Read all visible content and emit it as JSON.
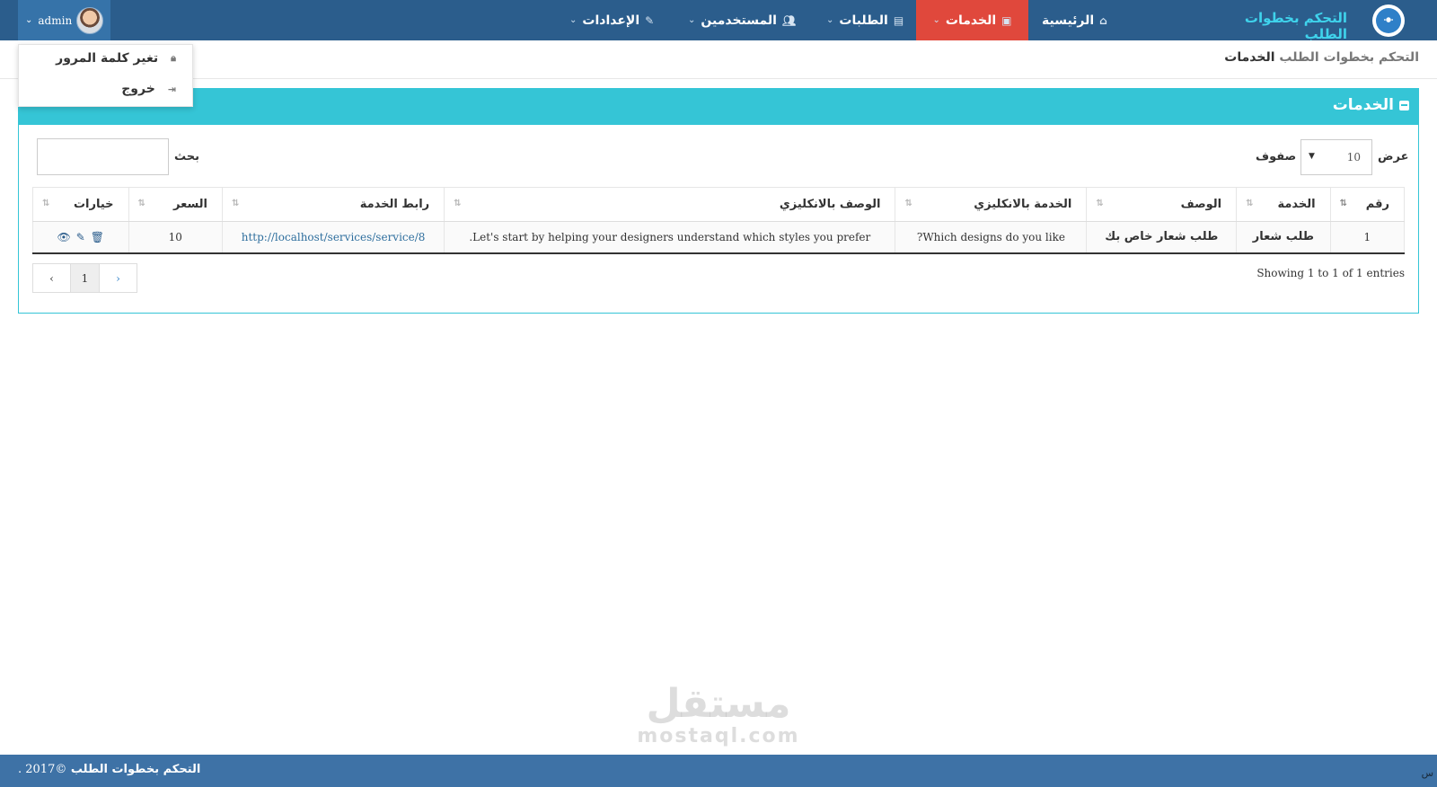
{
  "brand": {
    "name": "التحكم بخطوات الطلب",
    "logo_icon": "people-logo-icon"
  },
  "nav": {
    "items": [
      {
        "label": "الرئيسية",
        "icon": "home-icon"
      },
      {
        "label": "الخدمات",
        "icon": "box-icon",
        "active": true
      },
      {
        "label": "الطلبات",
        "icon": "file-icon"
      },
      {
        "label": "المستخدمين",
        "icon": "users-icon"
      },
      {
        "label": "الإعدادات",
        "icon": "wrench-icon"
      }
    ]
  },
  "user": {
    "name": "admin"
  },
  "dropdown": {
    "change_password": "تغير كلمة المرور",
    "logout": "خروج"
  },
  "breadcrumb": {
    "root": "التحكم بخطوات الطلب",
    "current": "الخدمات"
  },
  "panel": {
    "title": "الخدمات",
    "show_label": "عرض",
    "rows_label": "صفوف",
    "page_length": "10",
    "search_label": "بحث"
  },
  "table": {
    "headers": [
      "رقم",
      "الخدمة",
      "الوصف",
      "الخدمة بالانكليزي",
      "الوصف بالانكليزي",
      "رابط الخدمة",
      "السعر",
      "خيارات"
    ],
    "rows": [
      {
        "num": "1",
        "service": "طلب شعار",
        "desc": "طلب شعار خاص بك",
        "service_en": "Which designs do you like?",
        "desc_en": "Let's start by helping your designers understand which styles you prefer.",
        "link": "http://localhost/services/service/8",
        "price": "10"
      }
    ]
  },
  "info_text": "Showing 1 to 1 of 1 entries",
  "pagination": {
    "prev": "‹",
    "page": "1",
    "next": "›"
  },
  "watermark": {
    "arabic": "مستقل",
    "latin": "mostaql.com"
  },
  "footer": {
    "brand": "التحكم بخطوات الطلب",
    "copy": "©2017 .",
    "corner": "س"
  },
  "colors": {
    "navbar": "#2b5d8c",
    "active": "#e0483c",
    "panel": "#35c5d6",
    "footer": "#3e72a6"
  }
}
